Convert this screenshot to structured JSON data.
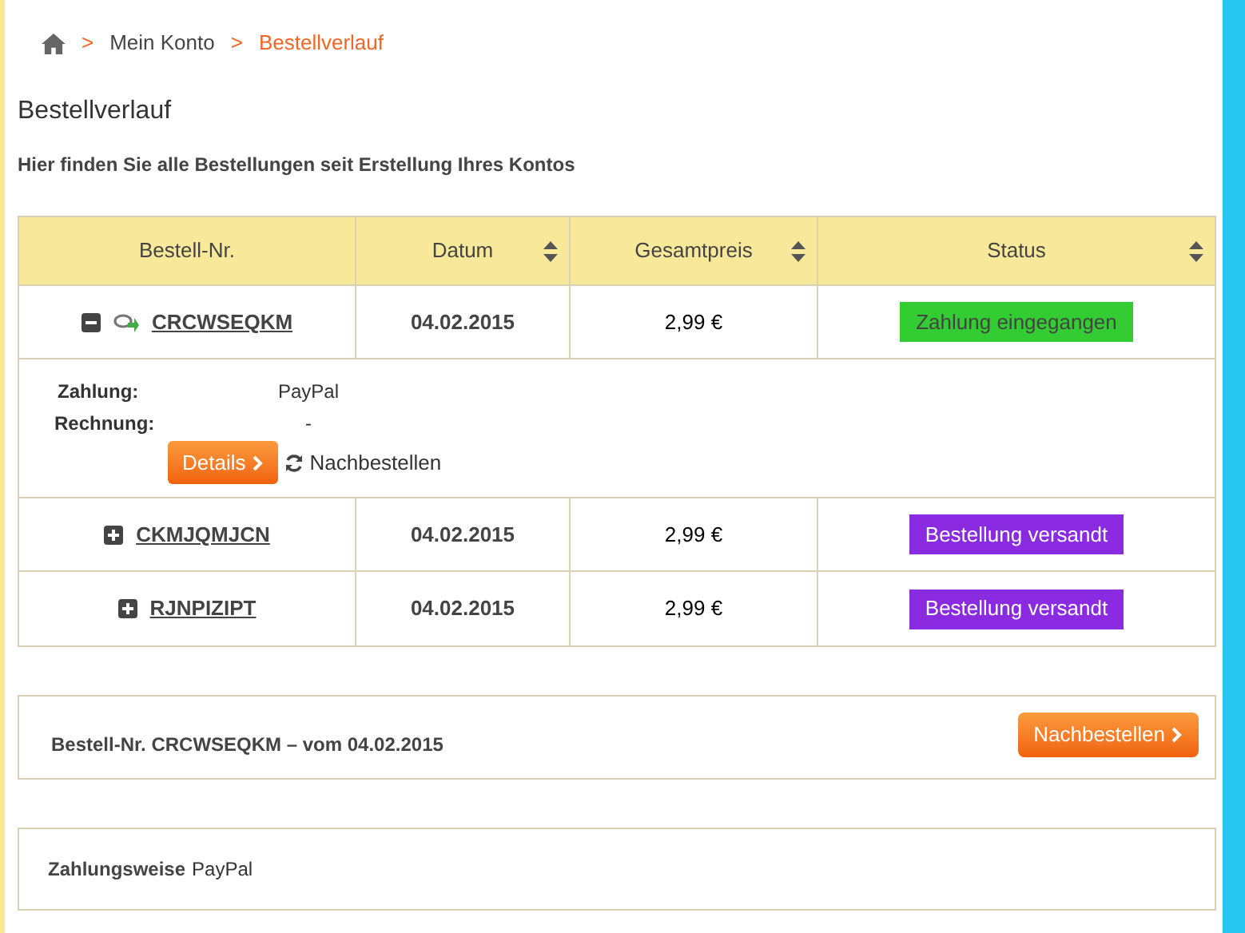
{
  "breadcrumb": [
    {
      "label": "Mein Konto",
      "current": false
    },
    {
      "label": "Bestellverlauf",
      "current": true
    }
  ],
  "breadcrumb_separator": ">",
  "title": "Bestellverlauf",
  "intro": "Hier finden Sie alle Bestellungen seit Erstellung Ihres Kontos",
  "table": {
    "columns": [
      {
        "label": "Bestell-Nr.",
        "sortable": false
      },
      {
        "label": "Datum",
        "sortable": true
      },
      {
        "label": "Gesamtpreis",
        "sortable": true
      },
      {
        "label": "Status",
        "sortable": true
      }
    ],
    "rows": [
      {
        "order": "CRCWSEQKM",
        "date": "04.02.2015",
        "price": "2,99 €",
        "status": "Zahlung eingegangen",
        "color": "#33cc33",
        "expanded": true,
        "details": {
          "payment_label": "Zahlung:",
          "payment": "PayPal",
          "invoice_label": "Rechnung:",
          "invoice": "-",
          "details_button": "Details",
          "reorder": "Nachbestellen"
        }
      },
      {
        "order": "CKMJQMJCN",
        "date": "04.02.2015",
        "price": "2,99 €",
        "status": "Bestellung versandt",
        "color": "#8a2be2",
        "expanded": false
      },
      {
        "order": "RJNPIZIPT",
        "date": "04.02.2015",
        "price": "2,99 €",
        "status": "Bestellung versandt",
        "color": "#8a2be2",
        "expanded": false
      }
    ]
  },
  "order_panel": {
    "heading": "Bestell-Nr. CRCWSEQKM – vom 04.02.2015",
    "button": "Nachbestellen"
  },
  "payment_panel": {
    "label": "Zahlungsweise",
    "value": "PayPal"
  }
}
